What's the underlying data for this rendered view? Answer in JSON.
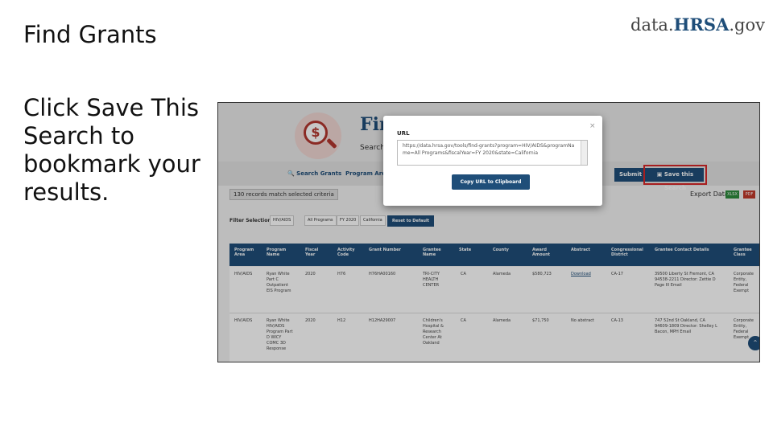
{
  "slide": {
    "title": "Find Grants",
    "body": "Click Save This Search to bookmark your results.",
    "logo_prefix": "data.",
    "logo_brand": "HRSA",
    "logo_suffix": ".gov"
  },
  "screenshot": {
    "page_heading": "Fin",
    "page_sub": "Search",
    "dollar_icon": "$",
    "toolbar": {
      "search_label": "Search Grants",
      "program_label": "Program Area",
      "submit_label": "Submit",
      "save_label": "Save this Search"
    },
    "records_text": "130 records match selected criteria",
    "export_label": "Export Data",
    "export_xlsx": "XLSX",
    "export_pdf": "PDF",
    "filter_label": "Filter Selections:",
    "filter_chips": [
      "HIV/AIDS",
      "All Programs",
      "FY 2020",
      "California"
    ],
    "reset_label": "Reset to Default",
    "columns": [
      "Program Area",
      "Program Name",
      "Fiscal Year",
      "Activity Code",
      "Grant Number",
      "Grantee Name",
      "State",
      "County",
      "Award Amount",
      "Abstract",
      "Congressional District",
      "Grantee Contact Details",
      "Grantee Class"
    ],
    "rows": [
      {
        "program_area": "HIV/AIDS",
        "program_name": "Ryan White Part C Outpatient EIS Program",
        "fiscal_year": "2020",
        "activity_code": "H76",
        "grant_number": "H76HA00160",
        "grantee_name": "TRI-CITY HEALTH CENTER",
        "state": "CA",
        "county": "Alameda",
        "award_amount": "$580,723",
        "abstract": "Download",
        "district": "CA-17",
        "contact": "39500 Liberty St Fremont, CA 94538-2211 Director: Zettie D Page III Email",
        "class": "Corporate Entity, Federal Exempt"
      },
      {
        "program_area": "HIV/AIDS",
        "program_name": "Ryan White HIV/AIDS Program Part D WICY COMC 3D Response",
        "fiscal_year": "2020",
        "activity_code": "H12",
        "grant_number": "H12HA29007",
        "grantee_name": "Children's Hospital & Research Center At Oakland",
        "state": "CA",
        "county": "Alameda",
        "award_amount": "$71,750",
        "abstract": "No abstract",
        "district": "CA-13",
        "contact": "747 52nd St Oakland, CA 94609-1809 Director: Shelley L Bacon, MPH Email",
        "class": "Corporate Entity, Federal Exempt"
      }
    ],
    "modal": {
      "label": "URL",
      "url": "https://data.hrsa.gov/tools/find-grants?program=HIV/AIDS&programName=All Programs&fiscalYear=FY 2020&state=California",
      "copy_label": "Copy URL to Clipboard",
      "close": "×"
    }
  },
  "colors": {
    "brand_blue": "#1f4e79",
    "highlight_red": "#d62728",
    "accent_red": "#b3362f"
  }
}
